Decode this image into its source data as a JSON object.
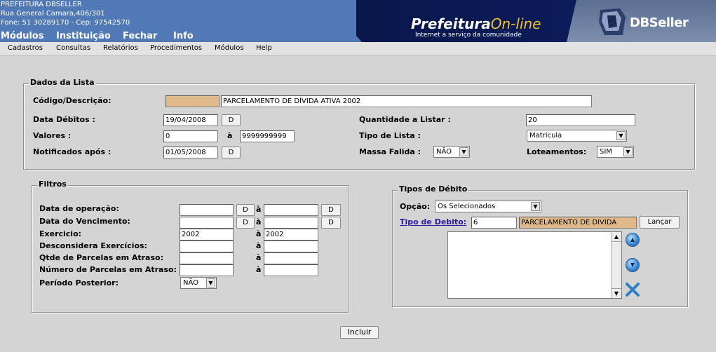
{
  "header": {
    "municipality": "PREFEITURA DBSELLER",
    "address": "Rua General Camara,406/301",
    "phone": "Fone: 51 30289170  -  Cep: 97542570",
    "menu": [
      "Módulos",
      "Instituição",
      "Fechar",
      "Info"
    ],
    "brand_main": "Prefeitura",
    "brand_accent": "On-line",
    "brand_tagline": "Internet a serviço da comunidade",
    "vendor": "DBSeller"
  },
  "submenu": [
    "Cadastros",
    "Consultas",
    "Relatórios",
    "Procedimentos",
    "Módulos",
    "Help"
  ],
  "dados_lista": {
    "legend": "Dados da Lista",
    "codigo_label": "Código/Descrição:",
    "codigo_value": "",
    "descricao_value": "PARCELAMENTO DE DÍVIDA ATIVA 2002",
    "data_debitos_label": "Data Débitos :",
    "data_debitos_value": "19/04/2008",
    "valores_label": "Valores :",
    "valores_from": "0",
    "valores_sep": "à",
    "valores_to": "9999999999",
    "notificados_label": "Notificados após :",
    "notificados_value": "01/05/2008",
    "quantidade_label": "Quantidade a Listar :",
    "quantidade_value": "20",
    "tipo_lista_label": "Tipo de Lista :",
    "tipo_lista_value": "Matrícula",
    "massa_falida_label": "Massa Falida :",
    "massa_falida_value": "NÃO",
    "loteamentos_label": "Loteamentos:",
    "loteamentos_value": "SIM",
    "d_button": "D"
  },
  "filtros": {
    "legend": "Filtros",
    "sep": "à",
    "d_button": "D",
    "rows": [
      {
        "label": "Data de operação:",
        "from": "",
        "to": ""
      },
      {
        "label": "Data do Vencimento:",
        "from": "",
        "to": ""
      },
      {
        "label": "Exercicio:",
        "from": "2002",
        "to": "2002"
      },
      {
        "label": "Desconsidera Exercícios:",
        "from": "",
        "to": ""
      },
      {
        "label": "Qtde de Parcelas em Atraso:",
        "from": "",
        "to": ""
      },
      {
        "label": "Número de Parcelas em Atraso:",
        "from": "",
        "to": ""
      }
    ],
    "periodo_label": "Período Posterior:",
    "periodo_value": "NÃO"
  },
  "tipos_debito": {
    "legend": "Tipos de Débito",
    "opcao_label": "Opção:",
    "opcao_value": "Os Selecionados",
    "tipo_link": "Tipo de Debito:",
    "tipo_code": "6",
    "tipo_desc": "PARCELAMENTO DE DIVIDA",
    "lancar_button": "Lançar"
  },
  "incluir_button": "Incluir",
  "colors": {
    "header_blue": "#5079b6",
    "brand_navy": "#0b1c5a",
    "accent_tan": "#e0b98b",
    "link_purple": "#2a1b9a"
  }
}
